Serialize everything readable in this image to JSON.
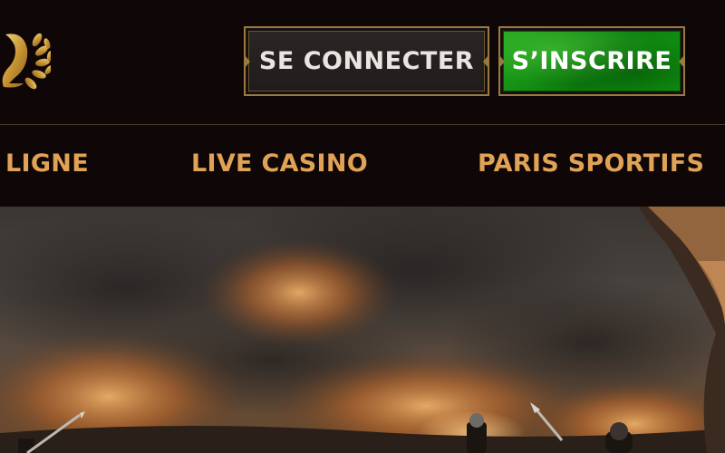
{
  "header": {
    "login_label": "SE CONNECTER",
    "register_label": "S’INSCRIRE",
    "logo_icon": "laurel-crown-logo-icon"
  },
  "nav": {
    "items": [
      {
        "label": "LIGNE"
      },
      {
        "label": "LIVE CASINO"
      },
      {
        "label": "PARIS SPORTIFS"
      }
    ]
  },
  "hero": {
    "image": "battle-scene-banner"
  },
  "colors": {
    "background": "#0f0707",
    "nav_text": "#e0a356",
    "gold_border": "#9a7a3e",
    "register_green": "#139a13",
    "login_text": "#e9e6e1"
  }
}
